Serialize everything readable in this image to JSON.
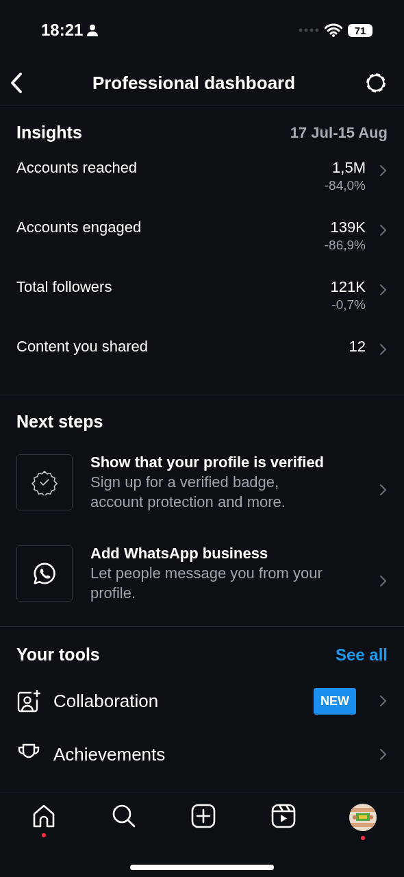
{
  "status_bar": {
    "time": "18:21",
    "battery": "71"
  },
  "header": {
    "title": "Professional dashboard"
  },
  "insights": {
    "title": "Insights",
    "date_range": "17 Jul-15 Aug",
    "rows": [
      {
        "label": "Accounts reached",
        "value": "1,5M",
        "change": "-84,0%"
      },
      {
        "label": "Accounts engaged",
        "value": "139K",
        "change": "-86,9%"
      },
      {
        "label": "Total followers",
        "value": "121K",
        "change": "-0,7%"
      },
      {
        "label": "Content you shared",
        "value": "12"
      }
    ]
  },
  "next_steps": {
    "title": "Next steps",
    "items": [
      {
        "kind": "verified",
        "title": "Show that your profile is verified",
        "description": "Sign up for a verified badge, account protection and more."
      },
      {
        "kind": "whatsapp",
        "title": "Add WhatsApp business",
        "description": "Let people message you from your profile."
      }
    ]
  },
  "tools": {
    "title": "Your tools",
    "see_all": "See all",
    "items": [
      {
        "kind": "collaboration",
        "label": "Collaboration",
        "badge": "NEW"
      },
      {
        "kind": "achievements",
        "label": "Achievements"
      }
    ]
  },
  "tab_bar": {
    "items": [
      {
        "kind": "home",
        "notification": true
      },
      {
        "kind": "search",
        "notification": false
      },
      {
        "kind": "create",
        "notification": false
      },
      {
        "kind": "reels",
        "notification": false
      },
      {
        "kind": "profile",
        "notification": true
      }
    ]
  }
}
